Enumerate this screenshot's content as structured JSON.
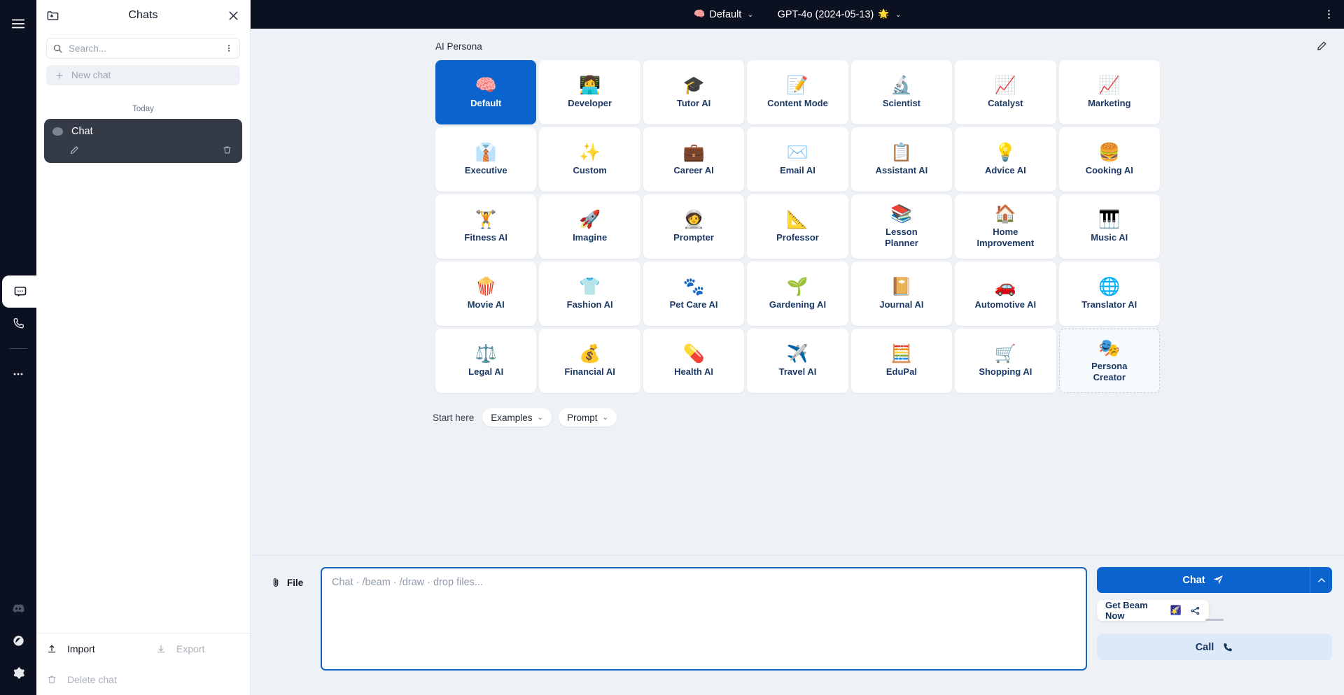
{
  "rail": {
    "menu_icon": "hamburger-menu-icon",
    "chat_icon": "chat-bubble-icon",
    "call_icon": "phone-icon",
    "more_icon": "ellipsis-icon",
    "discord_icon": "discord-icon",
    "dark_mode_icon": "contrast-icon",
    "settings_icon": "gear-icon"
  },
  "drawer": {
    "folder_icon": "folder-down-icon",
    "title": "Chats",
    "close_icon": "close-icon",
    "search": {
      "placeholder": "Search...",
      "value": "",
      "icon": "search-icon",
      "menu_icon": "vertical-dots-icon"
    },
    "new_chat": {
      "label": "New chat",
      "icon": "plus-icon"
    },
    "day_label": "Today",
    "chat_item": {
      "name": "Chat",
      "avatar": "brain-icon",
      "edit_icon": "pencil-icon",
      "delete_icon": "trash-icon"
    },
    "footer": {
      "import": {
        "label": "Import",
        "icon": "upload-icon"
      },
      "export": {
        "label": "Export",
        "icon": "download-icon"
      },
      "delete_chat": {
        "label": "Delete chat",
        "icon": "trash-icon"
      }
    }
  },
  "topbar": {
    "persona": {
      "emoji": "🧠",
      "label": "Default",
      "caret": "⌄"
    },
    "model": {
      "label": "GPT-4o (2024-05-13)",
      "emoji": "🌟",
      "caret": "⌄"
    },
    "overflow_icon": "vertical-dots-icon"
  },
  "persona_panel": {
    "title": "AI Persona",
    "edit_icon": "pencil-icon",
    "selected": "Default",
    "cards": [
      {
        "emoji": "🧠",
        "label": "Default",
        "selected": true
      },
      {
        "emoji": "👩‍💻",
        "label": "Developer",
        "selected": false
      },
      {
        "emoji": "🎓",
        "label": "Tutor AI",
        "selected": false
      },
      {
        "emoji": "📝",
        "label": "Content Mode",
        "selected": false
      },
      {
        "emoji": "🔬",
        "label": "Scientist",
        "selected": false
      },
      {
        "emoji": "📈",
        "label": "Catalyst",
        "selected": false
      },
      {
        "emoji": "📈",
        "label": "Marketing",
        "selected": false
      },
      {
        "emoji": "👔",
        "label": "Executive",
        "selected": false
      },
      {
        "emoji": "✨",
        "label": "Custom",
        "selected": false
      },
      {
        "emoji": "💼",
        "label": "Career AI",
        "selected": false
      },
      {
        "emoji": "✉️",
        "label": "Email AI",
        "selected": false
      },
      {
        "emoji": "📋",
        "label": "Assistant AI",
        "selected": false
      },
      {
        "emoji": "💡",
        "label": "Advice AI",
        "selected": false
      },
      {
        "emoji": "🍔",
        "label": "Cooking AI",
        "selected": false
      },
      {
        "emoji": "🏋️",
        "label": "Fitness AI",
        "selected": false
      },
      {
        "emoji": "🚀",
        "label": "Imagine",
        "selected": false
      },
      {
        "emoji": "🧑‍🚀",
        "label": "Prompter",
        "selected": false
      },
      {
        "emoji": "📐",
        "label": "Professor",
        "selected": false
      },
      {
        "emoji": "📚",
        "label": "Lesson Planner",
        "selected": false
      },
      {
        "emoji": "🏠",
        "label": "Home Improvement",
        "selected": false
      },
      {
        "emoji": "🎹",
        "label": "Music AI",
        "selected": false
      },
      {
        "emoji": "🍿",
        "label": "Movie AI",
        "selected": false
      },
      {
        "emoji": "👕",
        "label": "Fashion AI",
        "selected": false
      },
      {
        "emoji": "🐾",
        "label": "Pet Care AI",
        "selected": false
      },
      {
        "emoji": "🌱",
        "label": "Gardening AI",
        "selected": false
      },
      {
        "emoji": "📔",
        "label": "Journal AI",
        "selected": false
      },
      {
        "emoji": "🚗",
        "label": "Automotive AI",
        "selected": false
      },
      {
        "emoji": "🌐",
        "label": "Translator AI",
        "selected": false
      },
      {
        "emoji": "⚖️",
        "label": "Legal AI",
        "selected": false
      },
      {
        "emoji": "💰",
        "label": "Financial AI",
        "selected": false
      },
      {
        "emoji": "💊",
        "label": "Health AI",
        "selected": false
      },
      {
        "emoji": "✈️",
        "label": "Travel AI",
        "selected": false
      },
      {
        "emoji": "🧮",
        "label": "EduPal",
        "selected": false
      },
      {
        "emoji": "🛒",
        "label": "Shopping AI",
        "selected": false
      },
      {
        "emoji": "🎭",
        "label": "Persona Creator",
        "selected": false,
        "dashed": true
      }
    ]
  },
  "start_here": {
    "label": "Start here",
    "examples": {
      "label": "Examples",
      "caret": "⌄"
    },
    "prompt": {
      "label": "Prompt",
      "caret": "⌄"
    }
  },
  "composer": {
    "file": {
      "label": "File",
      "icon": "paperclip-icon"
    },
    "input": {
      "placeholder": "Chat · /beam · /draw · drop files...",
      "value": ""
    },
    "chat_button": {
      "label": "Chat",
      "icon": "send-icon"
    },
    "chat_caret": "chevron-up-icon",
    "beam": {
      "label": "Get Beam Now",
      "emoji": "🌠",
      "icon": "share-nodes-icon"
    },
    "call_button": {
      "label": "Call",
      "icon": "phone-icon"
    }
  },
  "colors": {
    "accent": "#0b63ce",
    "topbar_bg": "#0b1120",
    "page_bg": "#eef2f6",
    "card_label": "#1b3a66",
    "chat_item_bg": "#343a46"
  }
}
